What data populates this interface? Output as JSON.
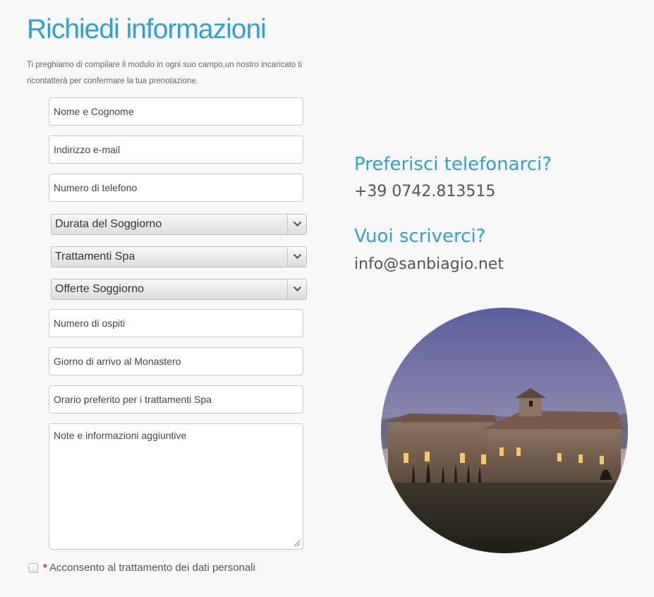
{
  "form": {
    "title": "Richiedi informazioni",
    "intro": "Ti preghiamo di compilare il modulo in ogni suo campo,un nostro incaricato ti ricontatterà per confermare la tua prenotazione.",
    "fields": {
      "name_placeholder": "Nome e Cognome",
      "email_placeholder": "Indirizzo e-mail",
      "phone_placeholder": "Numero di telefono",
      "guests_placeholder": "Numero di ospiti",
      "arrival_placeholder": "Giorno di arrivo al Monastero",
      "spa_time_placeholder": "Orario preferito per i trattamenti Spa",
      "notes_placeholder": "Note e informazioni aggiuntive"
    },
    "selects": {
      "duration": "Durata del Soggiorno",
      "spa": "Trattamenti Spa",
      "offers": "Offerte Soggiorno"
    },
    "consent": {
      "required_mark": "*",
      "label": "Acconsento al trattamento dei dati personali",
      "checked": false
    }
  },
  "contact": {
    "phone_heading": "Preferisci telefonarci?",
    "phone": "+39 0742.813515",
    "email_heading": "Vuoi scriverci?",
    "email": "info@sanbiagio.net"
  },
  "colors": {
    "accent": "#2ba2d6",
    "background": "#f8f8f8",
    "required": "#c0392b"
  },
  "icons": {
    "select_arrow": "chevron-down-icon",
    "textarea_resize": "resize-grip-icon",
    "photo": "monastery-photo"
  }
}
